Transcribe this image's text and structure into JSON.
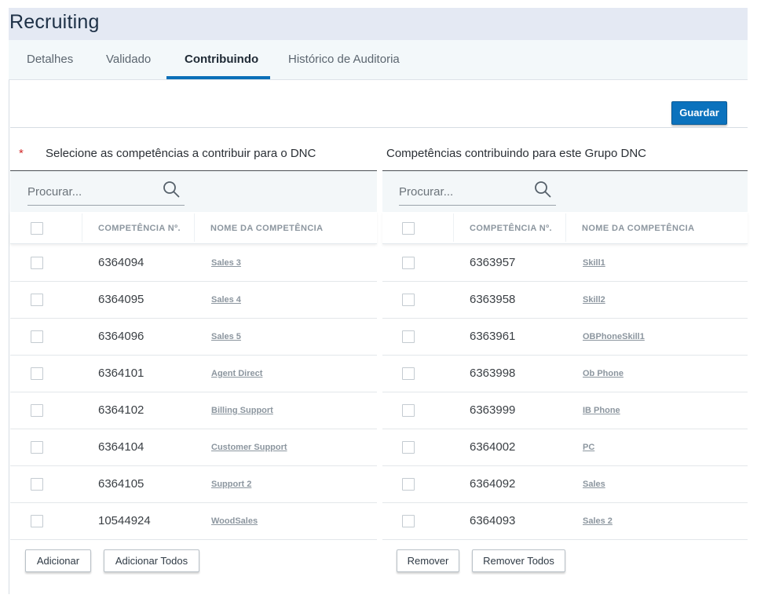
{
  "app": {
    "title": "Recruiting"
  },
  "tabs": [
    {
      "label": "Detalhes"
    },
    {
      "label": "Validado"
    },
    {
      "label": "Contribuindo",
      "active": true
    },
    {
      "label": "Histórico de Auditoria"
    }
  ],
  "toolbar": {
    "save_label": "Guardar"
  },
  "left_panel": {
    "required_marker": "*",
    "title": "Selecione as competências a contribuir para o DNC",
    "search": {
      "placeholder": "Procurar..."
    },
    "columns": {
      "number": "COMPETÊNCIA Nº.",
      "name": "NOME DA COMPETÊNCIA"
    },
    "rows": [
      {
        "number": "6364094",
        "name": "Sales 3"
      },
      {
        "number": "6364095",
        "name": "Sales 4"
      },
      {
        "number": "6364096",
        "name": "Sales 5"
      },
      {
        "number": "6364101",
        "name": "Agent Direct"
      },
      {
        "number": "6364102",
        "name": "Billing Support"
      },
      {
        "number": "6364104",
        "name": "Customer Support"
      },
      {
        "number": "6364105",
        "name": "Support 2"
      },
      {
        "number": "10544924",
        "name": "WoodSales"
      }
    ],
    "buttons": {
      "add": "Adicionar",
      "add_all": "Adicionar Todos"
    }
  },
  "right_panel": {
    "title": "Competências contribuindo para este Grupo DNC",
    "search": {
      "placeholder": "Procurar..."
    },
    "columns": {
      "number": "COMPETÊNCIA Nº.",
      "name": "NOME DA COMPETÊNCIA"
    },
    "rows": [
      {
        "number": "6363957",
        "name": "Skill1"
      },
      {
        "number": "6363958",
        "name": "Skill2"
      },
      {
        "number": "6363961",
        "name": "OBPhoneSkill1"
      },
      {
        "number": "6363998",
        "name": "Ob Phone"
      },
      {
        "number": "6363999",
        "name": "IB Phone"
      },
      {
        "number": "6364002",
        "name": "PC"
      },
      {
        "number": "6364092",
        "name": "Sales"
      },
      {
        "number": "6364093",
        "name": "Sales 2"
      }
    ],
    "buttons": {
      "remove": "Remover",
      "remove_all": "Remover Todos"
    }
  },
  "icons": {
    "search": "search-icon",
    "required": "required-asterisk"
  },
  "colors": {
    "accent": "#0b72bd",
    "required": "#d22a2a",
    "header_bg": "#e4e9f3"
  }
}
